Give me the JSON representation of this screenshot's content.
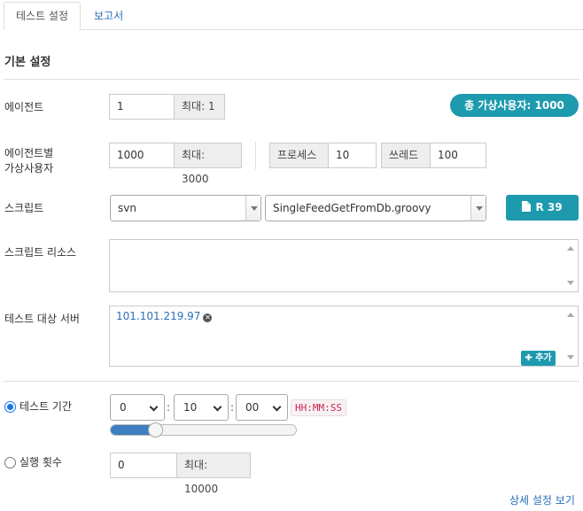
{
  "tabs": [
    {
      "label": "테스트 설정",
      "active": true
    },
    {
      "label": "보고서",
      "active": false
    }
  ],
  "section_title": "기본 설정",
  "agent": {
    "label": "에이전트",
    "value": "1",
    "max": "최대: 1",
    "total_vusers": "총 가상사용자: 1000"
  },
  "vuser_per_agent": {
    "label_line1": "에이전트별",
    "label_line2": "가상사용자",
    "value": "1000",
    "max": "최대: 3000",
    "process_label": "프로세스",
    "process_value": "10",
    "thread_label": "쓰레드",
    "thread_value": "100"
  },
  "script": {
    "label": "스크립트",
    "repo": "svn",
    "file": "SingleFeedGetFromDb.groovy",
    "revision_button": "R 39"
  },
  "script_resources": {
    "label": "스크립트 리소스",
    "value": ""
  },
  "target_servers": {
    "label": "테스트 대상 서버",
    "servers": [
      "101.101.219.97"
    ],
    "add_button": "추가"
  },
  "duration": {
    "label": "테스트 기간",
    "checked": true,
    "hours": "0",
    "minutes": "10",
    "seconds": "00",
    "format": "HH:MM:SS",
    "slider_fraction": 0.22
  },
  "run_count": {
    "label": "실행 횟수",
    "checked": false,
    "value": "0",
    "max": "최대: 10000"
  },
  "advanced_link": "상세 설정 보기",
  "colors": {
    "accent": "#1e9aae",
    "link": "#2a6fb7",
    "radio": "#1a73e8"
  }
}
